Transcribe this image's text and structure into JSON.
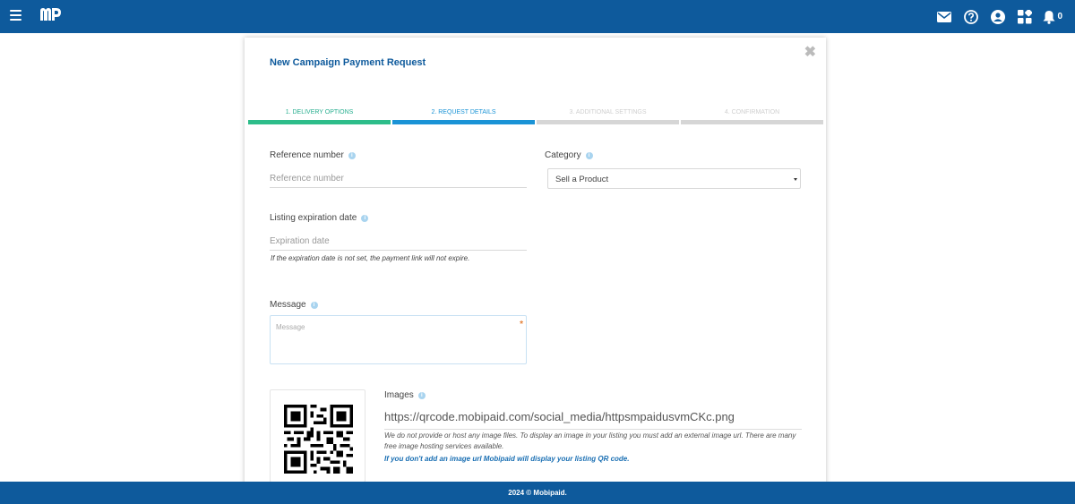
{
  "header": {
    "notification_count": "0",
    "icons": [
      "menu-icon",
      "mobipaid-logo",
      "mail-icon",
      "help-icon",
      "account-icon",
      "apps-icon",
      "bell-icon"
    ]
  },
  "modal": {
    "title": "New Campaign Payment Request",
    "close_label": "✖",
    "steps": [
      {
        "label": "1. DELIVERY OPTIONS",
        "state": "complete",
        "color": "#2dbd8a"
      },
      {
        "label": "2. REQUEST DETAILS",
        "state": "active",
        "color": "#1a93d6"
      },
      {
        "label": "3. ADDITIONAL SETTINGS",
        "state": "pending",
        "color": "#d6d6d6"
      },
      {
        "label": "4. CONFIRMATION",
        "state": "pending",
        "color": "#d6d6d6"
      }
    ],
    "reference": {
      "label": "Reference number",
      "placeholder": "Reference number"
    },
    "category": {
      "label": "Category",
      "value": "Sell a Product"
    },
    "expiration": {
      "label": "Listing expiration date",
      "placeholder": "Expiration date",
      "hint": "If the expiration date is not set, the payment link will not expire."
    },
    "message": {
      "label": "Message",
      "placeholder": "Message",
      "required_mark": "*"
    },
    "images": {
      "label": "Images",
      "url": "https://qrcode.mobipaid.com/social_media/httpsmpaidusvmCKc.png",
      "note": "We do not provide or host any image files. To display an image in your listing you must add an external image url. There are many free image hosting services available.",
      "note_highlight": "If you don't add an image url Mobipaid will display your listing QR code."
    }
  },
  "footer": {
    "text": "2024 © Mobipaid."
  },
  "colors": {
    "brand": "#0e5a9c",
    "step_done": "#2dbd8a",
    "step_active": "#1a93d6",
    "step_pending": "#d6d6d6"
  }
}
